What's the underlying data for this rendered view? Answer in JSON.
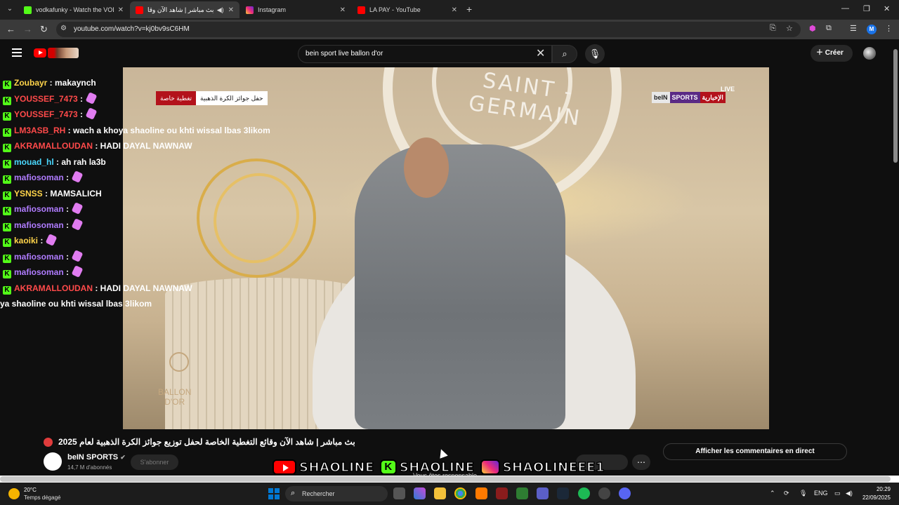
{
  "browser": {
    "tabs": [
      {
        "title": "vodkafunky - Watch the VOD o",
        "active": false,
        "favicon": "kick-icon"
      },
      {
        "title": "بث مباشر | شاهد الآن وقا",
        "active": true,
        "favicon": "youtube-icon"
      },
      {
        "title": "Instagram",
        "active": false,
        "favicon": "instagram-icon"
      },
      {
        "title": "LA PAY - YouTube",
        "active": false,
        "favicon": "youtube-icon"
      }
    ],
    "url": "youtube.com/watch?v=kj0bv9sC6HM",
    "profile_initial": "M"
  },
  "youtube": {
    "search_query": "bein sport live ballon d'or",
    "create_label": "Créer"
  },
  "video": {
    "overlay_badge_red": "تغطية خاصة",
    "overlay_badge_white": "حفل جوائز الكرة الذهبية",
    "channel_bug_1": "beIN",
    "channel_bug_2": "SPORTS",
    "channel_bug_3": "الإخبارية",
    "live_label": "LIVE",
    "backdrop_text": "SAINT - GERMAIN",
    "trophy_brand_line1": "BALLON",
    "trophy_brand_line2": "D'OR"
  },
  "chat": [
    {
      "user": "Zoubayr",
      "color": "yellow",
      "message": "makaynch",
      "emote": false
    },
    {
      "user": "YOUSSEF_7473",
      "color": "red",
      "message": "",
      "emote": true
    },
    {
      "user": "YOUSSEF_7473",
      "color": "red",
      "message": "",
      "emote": true
    },
    {
      "user": "LM3ASB_RH",
      "color": "red",
      "message": "wach a khoya shaoline ou khti wissal lbas 3likom",
      "emote": false
    },
    {
      "user": "AKRAMALLOUDAN",
      "color": "red",
      "message": "HADI DAYAL NAWNAW",
      "emote": false
    },
    {
      "user": "mouad_hl",
      "color": "cyan",
      "message": "ah rah la3b",
      "emote": false
    },
    {
      "user": "mafiosoman",
      "color": "purple",
      "message": "",
      "emote": true
    },
    {
      "user": "YSNSS",
      "color": "yellow",
      "message": "MAMSALICH",
      "emote": false
    },
    {
      "user": "mafiosoman",
      "color": "purple",
      "message": "",
      "emote": true
    },
    {
      "user": "mafiosoman",
      "color": "purple",
      "message": "",
      "emote": true
    },
    {
      "user": "kaoiki",
      "color": "yellow",
      "message": "",
      "emote": true
    },
    {
      "user": "mafiosoman",
      "color": "purple",
      "message": "",
      "emote": true
    },
    {
      "user": "mafiosoman",
      "color": "purple",
      "message": "",
      "emote": true
    },
    {
      "user": "AKRAMALLOUDAN",
      "color": "red",
      "message": "HADI DAYAL NAWNAW",
      "emote": false
    }
  ],
  "chat_fragment": "ya shaoline ou khti wissal lbas 3likom",
  "info": {
    "title": "بث مباشر | شاهد الآن وقائع التغطية الخاصة لحفل توزيع جوائز الكرة الذهبية لعام 2025",
    "channel": "beIN SPORTS",
    "subscribers": "14,7 M d'abonnés",
    "subscribe_label": "S'abonner",
    "live_chat_label": "Afficher les commentaires en direct",
    "disclaimer": "Vous êtes responsable"
  },
  "socials": [
    {
      "icon": "youtube-icon",
      "handle": "SHAOLINE"
    },
    {
      "icon": "kick-icon",
      "handle": "SHAOLINE"
    },
    {
      "icon": "instagram-icon",
      "handle": "SHAOLINEEE1"
    }
  ],
  "taskbar": {
    "temperature": "20°C",
    "weather": "Temps dégagé",
    "search_label": "Rechercher",
    "lang": "ENG",
    "time": "20:29",
    "date": "22/09/2025"
  },
  "colors": {
    "kick_green": "#53fc18",
    "youtube_red": "#ff0000",
    "user_yellow": "#ffd44a",
    "user_red": "#ff4a4a",
    "user_purple": "#b07cff",
    "user_cyan": "#4ad8ff"
  }
}
